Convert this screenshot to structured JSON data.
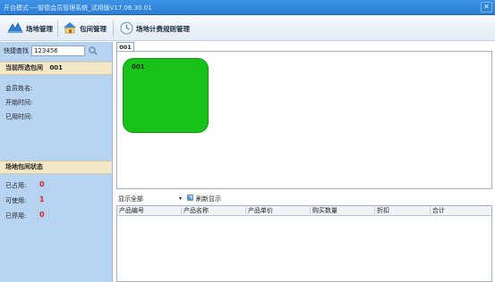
{
  "window": {
    "title": "开台模式----智德会员管理系统_试用版V17.06.30.01",
    "close_glyph": "✕"
  },
  "toolbar": {
    "venue_mgmt": "场地管理",
    "room_mgmt": "包间管理",
    "billing_rule_mgmt": "场地计费规则管理"
  },
  "left_panel": {
    "search_label": "快捷查找",
    "search_value": "123456",
    "current_room_label": "当前所选包间",
    "current_room_value": "001",
    "member_name_label": "会员姓名:",
    "start_time_label": "开始时间:",
    "used_time_label": "已用时间:",
    "status_header": "场地包间状态",
    "stats": [
      {
        "label": "已占用:",
        "value": "0"
      },
      {
        "label": "可使用:",
        "value": "1"
      },
      {
        "label": "已停用:",
        "value": "0"
      }
    ]
  },
  "main": {
    "tab_label": "001",
    "room_name": "001",
    "show_all": "显示全部",
    "dropdown_glyph": "▾",
    "refresh": "刷新显示",
    "columns": [
      "产品编号",
      "产品名称",
      "产品单价",
      "购买数量",
      "折扣",
      "合计"
    ]
  },
  "colors": {
    "room_available": "#18c218",
    "stat_value": "#e02020"
  }
}
